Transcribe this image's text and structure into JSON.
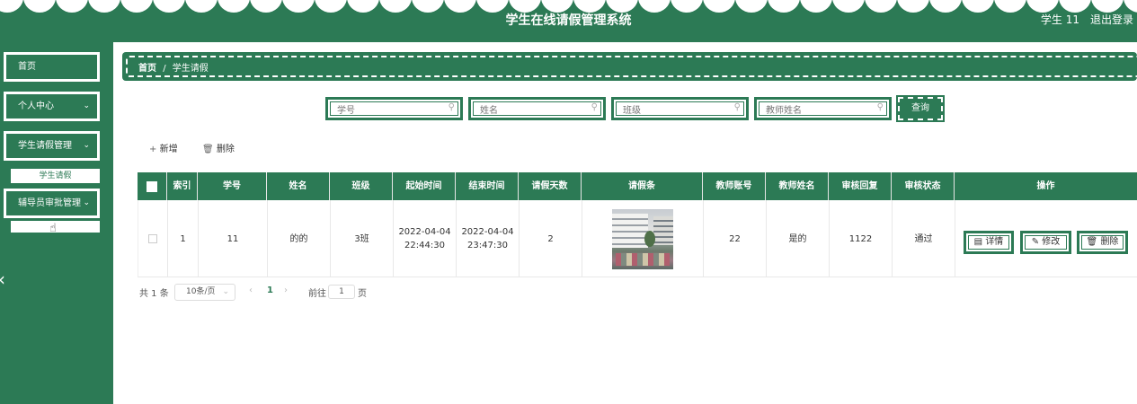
{
  "header": {
    "title": "学生在线请假管理系统",
    "user": "学生 11",
    "logout": "退出登录"
  },
  "sidebar": {
    "items": [
      {
        "label": "首页"
      },
      {
        "label": "个人中心"
      },
      {
        "label": "学生请假管理"
      },
      {
        "label": "辅导员审批管理"
      }
    ],
    "sub_label": "学生请假"
  },
  "breadcrumb": {
    "home": "首页",
    "sep": "/",
    "current": "学生请假"
  },
  "search": {
    "student_no_placeholder": "学号",
    "name_placeholder": "姓名",
    "class_placeholder": "班级",
    "teacher_placeholder": "教师姓名",
    "query_label": "查询"
  },
  "toolbar": {
    "add_label": "新增",
    "delete_label": "删除"
  },
  "table": {
    "headers": [
      "索引",
      "学号",
      "姓名",
      "班级",
      "起始时间",
      "结束时间",
      "请假天数",
      "请假条",
      "教师账号",
      "教师姓名",
      "审核回复",
      "审核状态",
      "操作"
    ],
    "rows": [
      {
        "index": "1",
        "student_no": "11",
        "name": "的的",
        "class": "3班",
        "start_date": "2022-04-04",
        "start_time": "22:44:30",
        "end_date": "2022-04-04",
        "end_time": "23:47:30",
        "days": "2",
        "teacher_account": "22",
        "teacher_name": "是的",
        "reply": "1122",
        "status": "通过",
        "actions": {
          "detail": "详情",
          "edit": "修改",
          "delete": "删除"
        }
      }
    ]
  },
  "pagination": {
    "total": "共 1 条",
    "page_size": "10条/页",
    "current_page": "1",
    "goto_label": "前往",
    "goto_value": "1",
    "page_suffix": "页"
  },
  "colors": {
    "primary": "#2c7a55",
    "background": "#ffffff"
  },
  "icons": {
    "search": "search-icon",
    "add": "plus-icon",
    "delete": "trash-icon",
    "detail": "document-icon",
    "edit": "edit-icon",
    "chevron": "chevron-down-icon"
  }
}
